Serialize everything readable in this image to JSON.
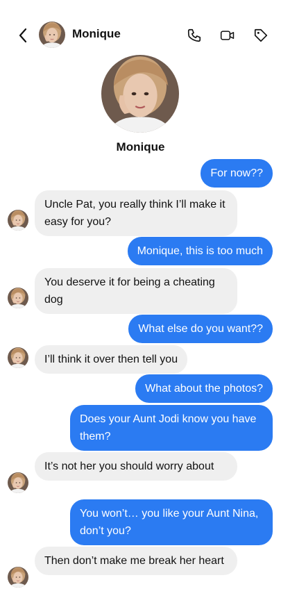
{
  "header": {
    "title": "Monique",
    "icons": [
      "chevron-left-icon",
      "phone-icon",
      "video-icon",
      "tag-icon"
    ]
  },
  "profile": {
    "name": "Monique"
  },
  "messages": [
    {
      "from": "me",
      "text": "For now??"
    },
    {
      "from": "them",
      "text": "Uncle Pat, you really think I’ll make it easy for you?"
    },
    {
      "from": "me",
      "text": "Monique, this is too much"
    },
    {
      "from": "them",
      "text": "You deserve it for being a cheating dog"
    },
    {
      "from": "me",
      "text": "What else do you want??"
    },
    {
      "from": "them",
      "text": "I’ll think it over then tell you"
    },
    {
      "from": "me",
      "text": "What about the photos?"
    },
    {
      "from": "me",
      "text": "Does your Aunt Jodi know you have them?"
    },
    {
      "from": "them",
      "text": "It’s not her you should worry about"
    },
    {
      "from": "me",
      "text": "You won’t… you like your Aunt Nina, don’t you?"
    },
    {
      "from": "them",
      "text": "Then don’t make me break her heart"
    }
  ],
  "colors": {
    "outgoing_bubble": "#2b7bf2",
    "incoming_bubble": "#efefef",
    "text_dark": "#111111"
  }
}
